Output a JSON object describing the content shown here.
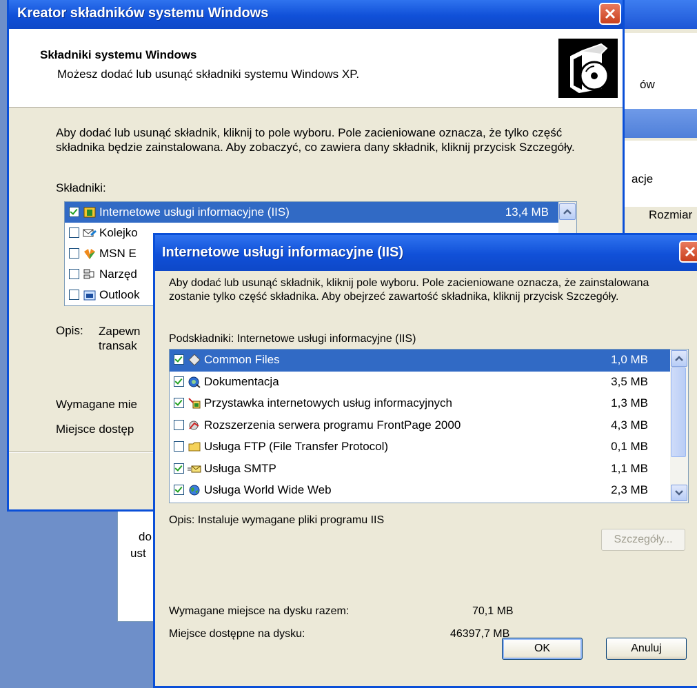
{
  "background_window": {
    "label_fragment_1": "ów",
    "label_fragment_2": "acje",
    "column_header": "Rozmiar",
    "panel_line_1": "do",
    "panel_line_2": "ust"
  },
  "wizard": {
    "title": "Kreator składników systemu Windows",
    "header_title": "Składniki systemu Windows",
    "header_subtitle": "Możesz dodać lub usunąć składniki systemu Windows XP.",
    "description": "Aby dodać lub usunąć składnik, kliknij to pole wyboru. Pole zacieniowane oznacza, że tylko część składnika będzie zainstalowana. Aby zobaczyć, co zawiera dany składnik, kliknij przycisk Szczegóły.",
    "components_label": "Składniki:",
    "components": [
      {
        "name": "Internetowe usługi informacyjne (IIS)",
        "size": "13,4 MB",
        "checked": true,
        "selected": true,
        "icon": "iis-icon"
      },
      {
        "name": "Kolejko",
        "size": "",
        "checked": false,
        "selected": false,
        "icon": "message-queue-icon"
      },
      {
        "name": "MSN E",
        "size": "",
        "checked": false,
        "selected": false,
        "icon": "msn-icon"
      },
      {
        "name": "Narzęd",
        "size": "",
        "checked": false,
        "selected": false,
        "icon": "tools-icon"
      },
      {
        "name": "Outlook",
        "size": "",
        "checked": false,
        "selected": false,
        "icon": "outlook-icon"
      }
    ],
    "opis_label": "Opis:",
    "opis_value": "Zapewn transak",
    "required_label": "Wymagane mie",
    "free_label": "Miejsce dostęp"
  },
  "dialog": {
    "title": "Internetowe usługi informacyjne (IIS)",
    "description": "Aby dodać lub usunąć składnik, kliknij pole wyboru. Pole zacieniowane oznacza, że zainstalowana zostanie tylko część składnika. Aby obejrzeć zawartość składnika, kliknij przycisk Szczegóły.",
    "subcomponents_label": "Podskładniki: Internetowe usługi informacyjne (IIS)",
    "subcomponents": [
      {
        "name": "Common Files",
        "size": "1,0 MB",
        "checked": true,
        "selected": true,
        "icon": "common-files-icon"
      },
      {
        "name": "Dokumentacja",
        "size": "3,5 MB",
        "checked": true,
        "selected": false,
        "icon": "documentation-icon"
      },
      {
        "name": "Przystawka internetowych usług informacyjnych",
        "size": "1,3 MB",
        "checked": true,
        "selected": false,
        "icon": "snap-in-icon"
      },
      {
        "name": "Rozszerzenia serwera programu FrontPage 2000",
        "size": "4,3 MB",
        "checked": false,
        "selected": false,
        "icon": "frontpage-icon"
      },
      {
        "name": "Usługa FTP (File Transfer Protocol)",
        "size": "0,1 MB",
        "checked": false,
        "selected": false,
        "icon": "ftp-folder-icon"
      },
      {
        "name": "Usługa SMTP",
        "size": "1,1 MB",
        "checked": true,
        "selected": false,
        "icon": "smtp-icon"
      },
      {
        "name": "Usługa World Wide Web",
        "size": "2,3 MB",
        "checked": true,
        "selected": false,
        "icon": "www-icon"
      }
    ],
    "opis": "Opis:  Instaluje wymagane pliki programu IIS",
    "required_label": "Wymagane miejsce na dysku razem:",
    "required_value": "70,1 MB",
    "free_label": "Miejsce dostępne na dysku:",
    "free_value": "46397,7 MB",
    "details_button": "Szczegóły...",
    "ok_button": "OK",
    "cancel_button": "Anuluj"
  },
  "colors": {
    "title_bar": "#1050d8",
    "selection": "#316ac5",
    "face": "#ece9d8"
  }
}
